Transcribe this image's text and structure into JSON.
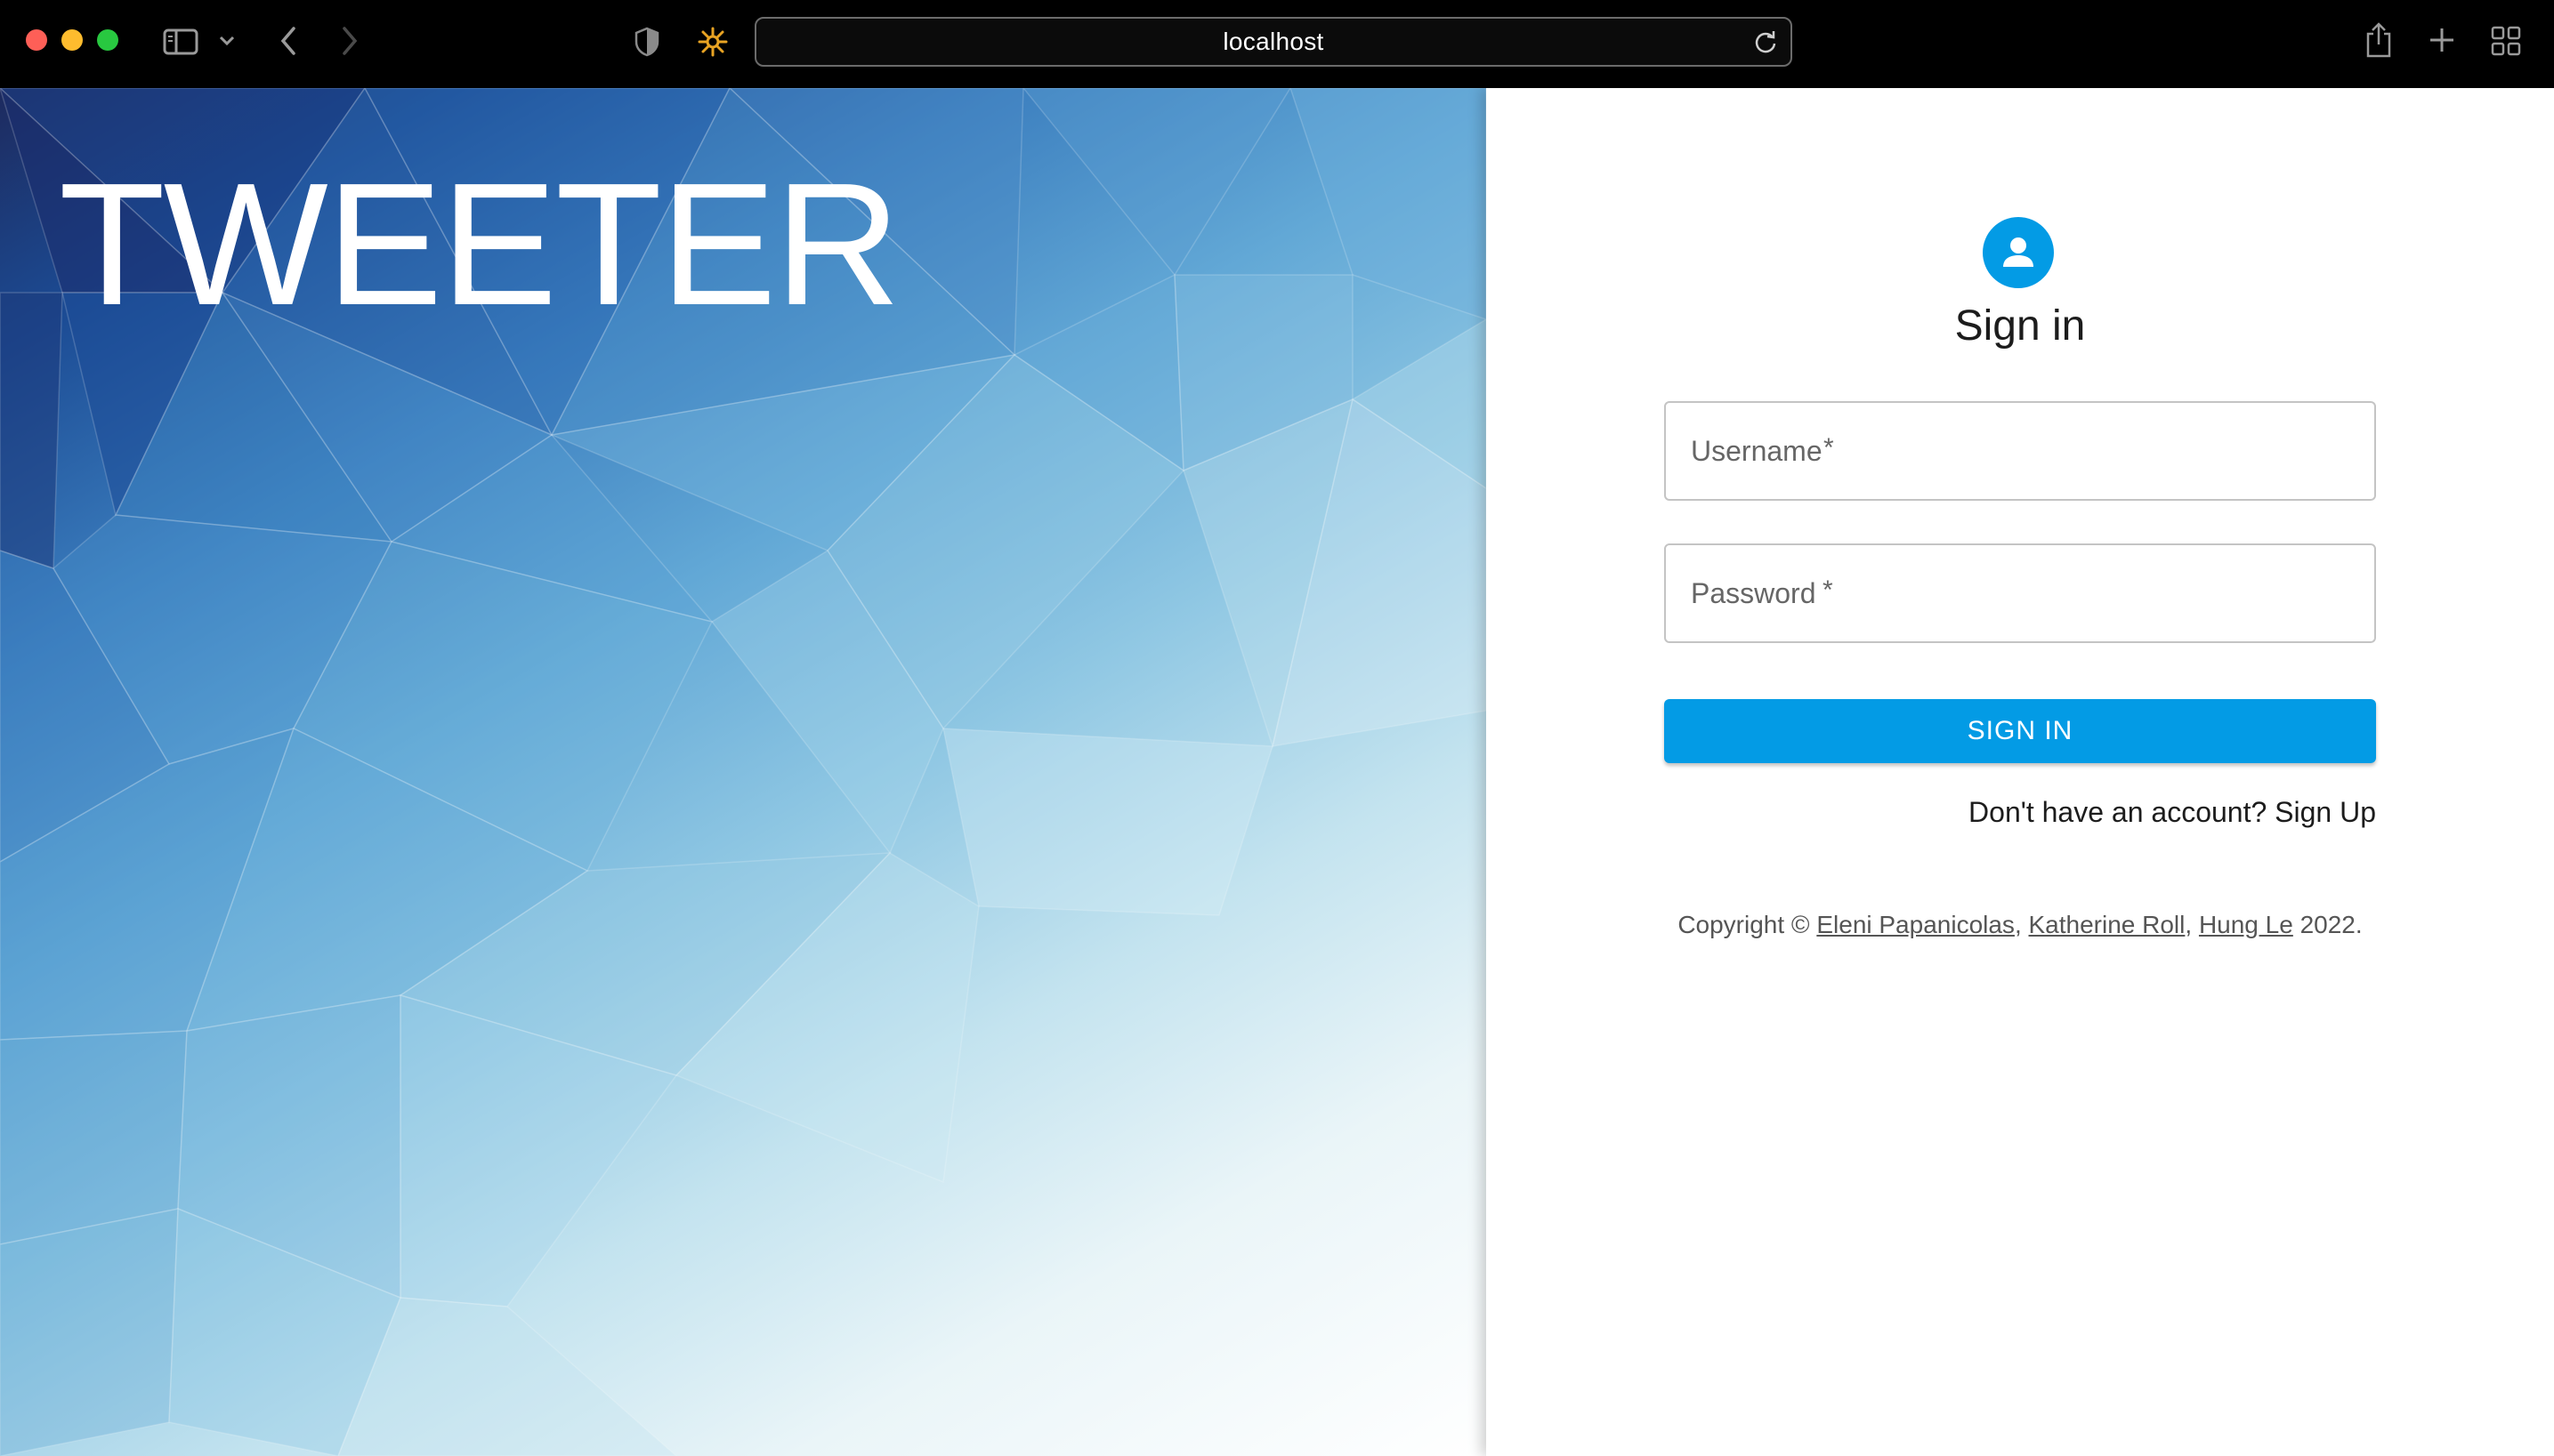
{
  "browser": {
    "url": "localhost",
    "icons": [
      "sidebar-icon",
      "chevron-down-icon",
      "back-icon",
      "forward-icon",
      "privacy-shield-icon",
      "extension-icon",
      "reload-icon",
      "share-icon",
      "new-tab-icon",
      "tab-overview-icon"
    ]
  },
  "hero": {
    "title": "TWEETER"
  },
  "signin": {
    "title": "Sign in",
    "username_placeholder": "Username",
    "password_placeholder": "Password",
    "required_marker": "*",
    "button_label": "SIGN IN",
    "signup_link": "Don't have an account? Sign Up",
    "copyright_prefix": "Copyright © ",
    "authors": [
      "Eleni Papanicolas",
      "Katherine Roll",
      "Hung Le"
    ],
    "copyright_separator": ", ",
    "copyright_suffix": " 2022."
  },
  "colors": {
    "accent": "#039be5",
    "hero_dark": "#1c4c95",
    "hero_light": "#eaf5f8"
  }
}
